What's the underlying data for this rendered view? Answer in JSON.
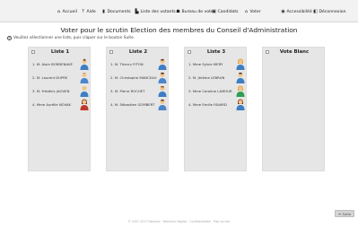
{
  "nav": {
    "accueil": "Accueil",
    "aide": "Aide",
    "documents": "Documents",
    "liste_votants": "Liste des votants",
    "bureau": "Bureau de vote",
    "candidats": "Candidats",
    "voter": "Voter",
    "accessibilite": "Accessibilité",
    "deconnexion": "Déconnexion"
  },
  "page": {
    "title": "Voter pour le scrutin Election des membres du Conseil d'Administration",
    "instruction": "Veuillez sélectionner une liste, puis cliquer sur le bouton Suite."
  },
  "lists": [
    {
      "title": "Liste 1",
      "candidates": [
        "1. M. Alain BORDENAVE",
        "2. M. Laurent DUPRE",
        "3. M. Frédéric JAOUEN",
        "4. Mme Aurélie NOVAK"
      ]
    },
    {
      "title": "Liste 2",
      "candidates": [
        "1. M. Thierry FITON",
        "2. M. Christophe MANCEAU",
        "3. M. Pierre ROCHET",
        "4. M. Sébastien GOMBERT"
      ]
    },
    {
      "title": "Liste 3",
      "candidates": [
        "1. Mme Sylvie MERY",
        "2. M. Jérôme LEBRUN",
        "3. Mme Caroline LAMOUR",
        "4. Mme Emilie FAVARD"
      ]
    },
    {
      "title": "Vote Blanc",
      "candidates": []
    }
  ],
  "buttons": {
    "suite": "Suite"
  },
  "footer": "© 2007-2017 Neovote · Mentions légales · Confidentialité · Plan du site"
}
